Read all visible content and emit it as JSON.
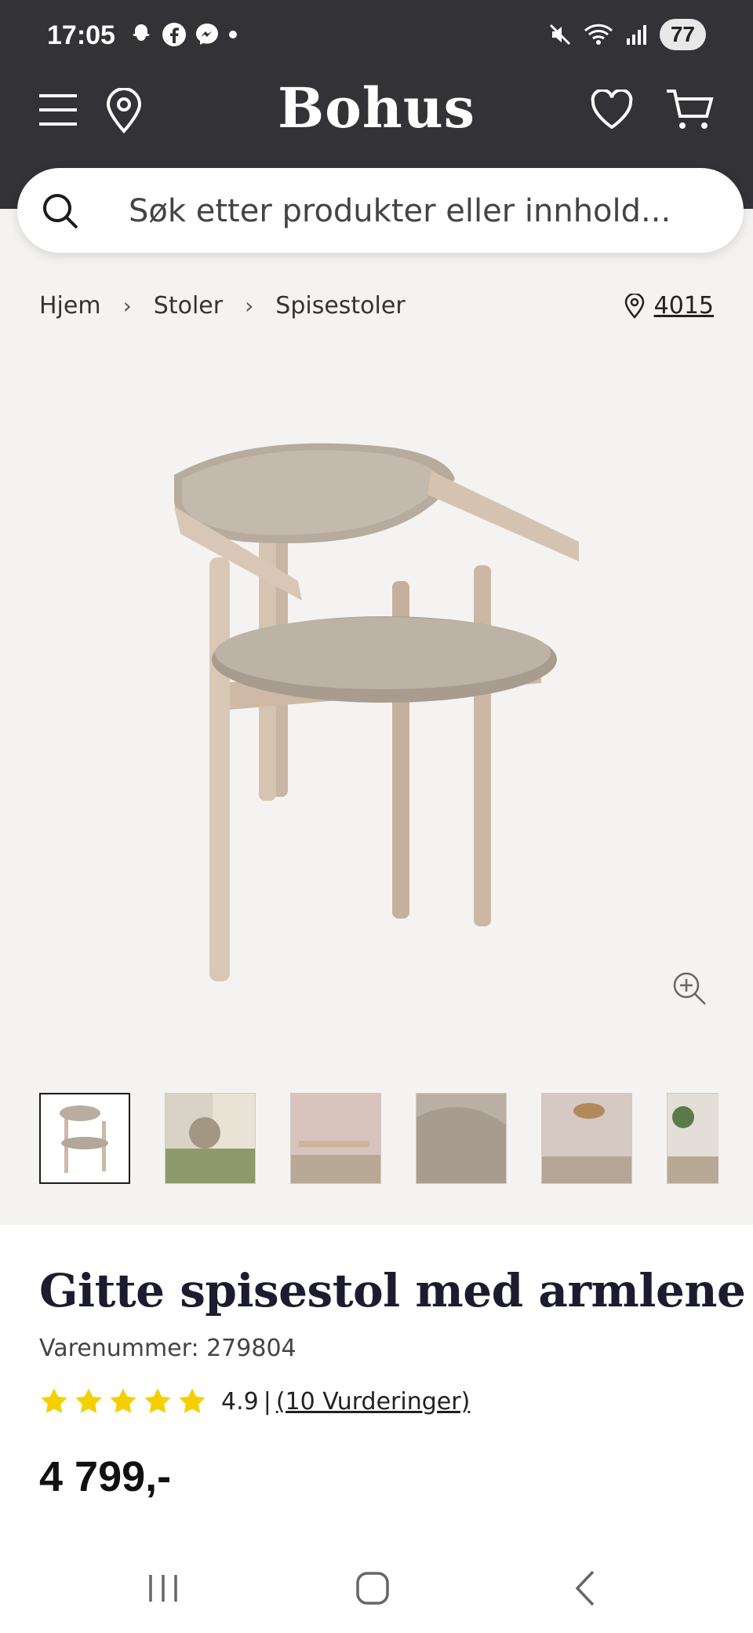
{
  "status": {
    "time": "17:05",
    "battery": "77"
  },
  "header": {
    "logo": "Bohus"
  },
  "search": {
    "placeholder": "Søk etter produkter eller innhold..."
  },
  "breadcrumb": {
    "items": [
      "Hjem",
      "Stoler",
      "Spisestoler"
    ],
    "separator": "›"
  },
  "store": {
    "code": "4015"
  },
  "product": {
    "title": "Gitte spisestol med armlene",
    "sku": "Varenummer: 279804",
    "rating_value": "4.9",
    "rating_divider": "|",
    "reviews": "(10 Vurderinger)",
    "stars": 5,
    "price": "4 799,-"
  },
  "colors": {
    "header_bg": "#333236",
    "star": "#f5cf00",
    "page_bg": "#f5f3f1"
  },
  "icons": [
    "menu-icon",
    "location-pin-icon",
    "heart-icon",
    "cart-icon",
    "search-icon",
    "zoom-in-icon"
  ]
}
